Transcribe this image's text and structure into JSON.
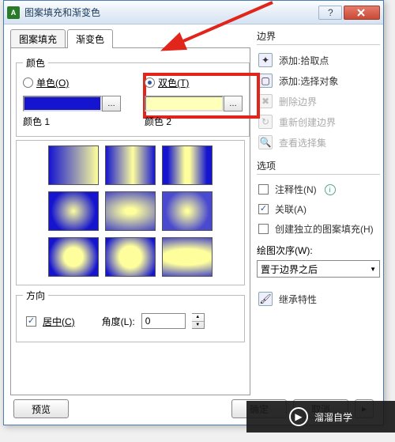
{
  "window": {
    "title": "图案填充和渐变色"
  },
  "tabs": {
    "fill": "图案填充",
    "gradient": "渐变色"
  },
  "colorGroup": {
    "legend": "颜色",
    "single": "单色(O)",
    "two": "双色(T)",
    "label1": "颜色 1",
    "label2": "颜色 2"
  },
  "directionGroup": {
    "legend": "方向",
    "center": "居中(C)",
    "angleLabel": "角度(L):",
    "angleValue": "0"
  },
  "boundary": {
    "header": "边界",
    "addPick": "添加:拾取点",
    "addSelect": "添加:选择对象",
    "delete": "删除边界",
    "recreate": "重新创建边界",
    "viewSel": "查看选择集"
  },
  "options": {
    "header": "选项",
    "annotative": "注释性(N)",
    "assoc": "关联(A)",
    "independent": "创建独立的图案填充(H)",
    "drawOrderLabel": "绘图次序(W):",
    "drawOrderValue": "置于边界之后"
  },
  "inherit": "继承特性",
  "footer": {
    "preview": "预览",
    "ok": "确定",
    "cancel": "取消"
  },
  "watermark": "溜溜自学"
}
